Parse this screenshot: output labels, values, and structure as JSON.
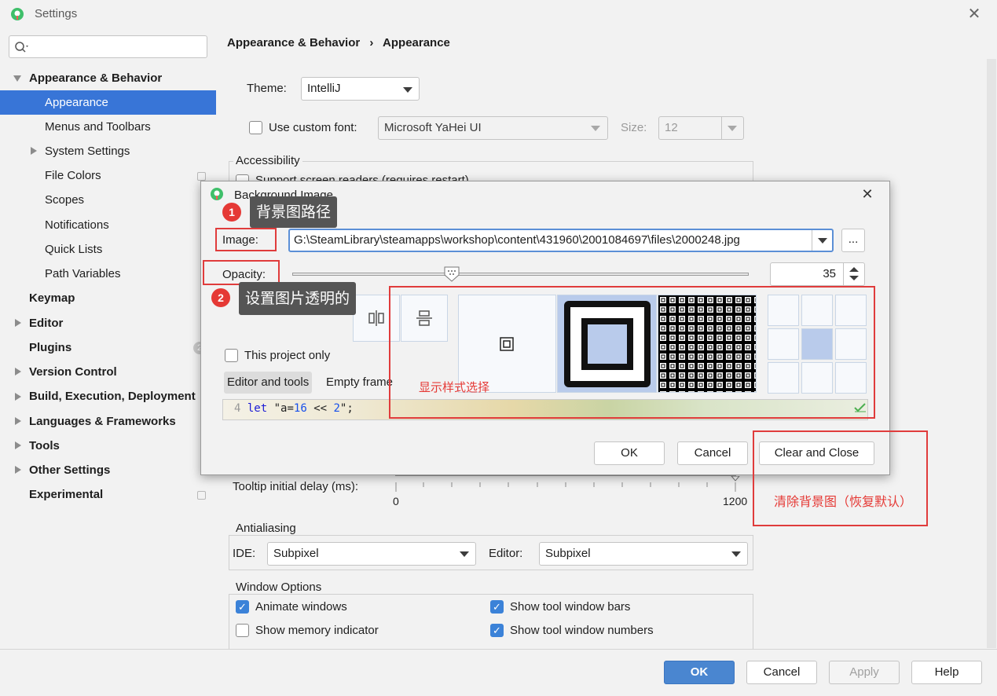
{
  "window": {
    "title": "Settings",
    "close": "✕"
  },
  "sidebar": {
    "items": [
      {
        "label": "Appearance & Behavior"
      },
      {
        "label": "Appearance"
      },
      {
        "label": "Menus and Toolbars"
      },
      {
        "label": "System Settings"
      },
      {
        "label": "File Colors"
      },
      {
        "label": "Scopes"
      },
      {
        "label": "Notifications"
      },
      {
        "label": "Quick Lists"
      },
      {
        "label": "Path Variables"
      },
      {
        "label": "Keymap"
      },
      {
        "label": "Editor"
      },
      {
        "label": "Plugins"
      },
      {
        "label": "Version Control"
      },
      {
        "label": "Build, Execution, Deployment"
      },
      {
        "label": "Languages & Frameworks"
      },
      {
        "label": "Tools"
      },
      {
        "label": "Other Settings"
      },
      {
        "label": "Experimental"
      }
    ],
    "plugins_badge": "2"
  },
  "main": {
    "breadcrumb": {
      "part1": "Appearance & Behavior",
      "sep": "›",
      "part2": "Appearance"
    },
    "theme_label": "Theme:",
    "theme_value": "IntelliJ",
    "custom_font_label": "Use custom font:",
    "custom_font_value": "Microsoft YaHei UI",
    "size_label": "Size:",
    "size_value": "12",
    "accessibility_title": "Accessibility",
    "screen_readers_label": "Support screen readers (requires restart)",
    "tooltip_delay_label": "Tooltip initial delay (ms):",
    "tooltip_min": "0",
    "tooltip_max": "1200",
    "antialiasing_title": "Antialiasing",
    "ide_label": "IDE:",
    "ide_value": "Subpixel",
    "editor_label": "Editor:",
    "editor_value": "Subpixel",
    "window_options_title": "Window Options",
    "animate_windows": "Animate windows",
    "show_memory": "Show memory indicator",
    "show_tool_bars": "Show tool window bars",
    "show_tool_numbers": "Show tool window numbers"
  },
  "buttons": {
    "ok": "OK",
    "cancel": "Cancel",
    "apply": "Apply",
    "help": "Help"
  },
  "dialog": {
    "title": "Background Image",
    "close": "✕",
    "image_label": "Image:",
    "image_path": "G:\\SteamLibrary\\steamapps\\workshop\\content\\431960\\2001084697\\files\\2000248.jpg",
    "browse": "...",
    "opacity_label": "Opacity:",
    "opacity_value": "35",
    "opacity_fraction": 0.35,
    "this_project_only": "This project only",
    "tab_editor_tools": "Editor and tools",
    "tab_empty_frame": "Empty frame",
    "code_line_no": "4",
    "code_kw": "let",
    "code_str1": "\"a=",
    "code_num1": "16",
    "code_op": " << ",
    "code_num2": "2",
    "code_end": "\";",
    "ok": "OK",
    "cancel": "Cancel",
    "clear_close": "Clear and Close"
  },
  "annotations": {
    "badge1": "1",
    "callout1": "背景图路径",
    "badge2": "2",
    "callout2": "设置图片透明的",
    "display_style": "显示样式选择",
    "clear_note": "清除背景图（恢复默认）"
  }
}
